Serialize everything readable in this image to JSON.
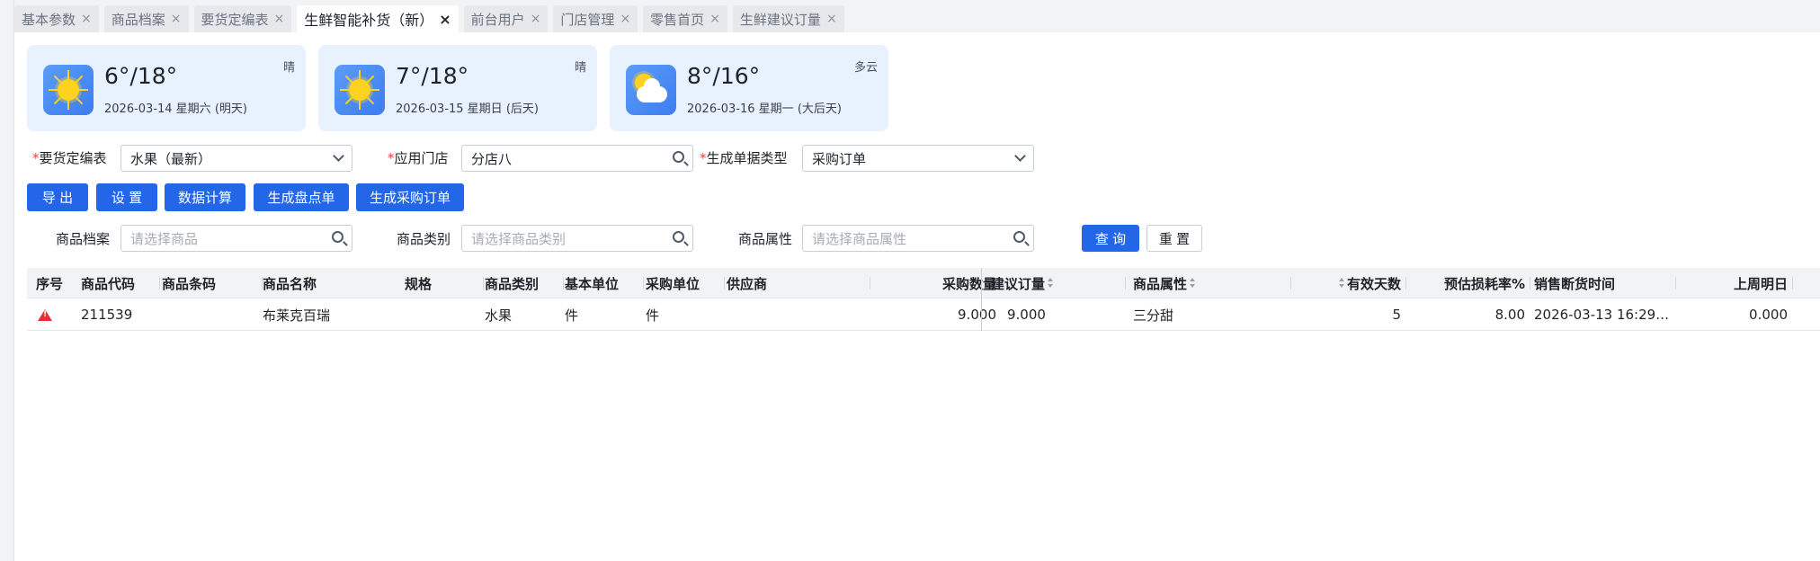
{
  "tabs": [
    {
      "label": "基本参数",
      "active": false
    },
    {
      "label": "商品档案",
      "active": false
    },
    {
      "label": "要货定编表",
      "active": false
    },
    {
      "label": "生鲜智能补货（新）",
      "active": true
    },
    {
      "label": "前台用户",
      "active": false
    },
    {
      "label": "门店管理",
      "active": false
    },
    {
      "label": "零售首页",
      "active": false
    },
    {
      "label": "生鲜建议订量",
      "active": false
    }
  ],
  "tab_close_glyph": "×",
  "weather": [
    {
      "temp": "6°/18°",
      "date": "2026-03-14 星期六 (明天)",
      "condition": "晴",
      "icon": "sun-icon"
    },
    {
      "temp": "7°/18°",
      "date": "2026-03-15 星期日 (后天)",
      "condition": "晴",
      "icon": "sun-icon"
    },
    {
      "temp": "8°/16°",
      "date": "2026-03-16 星期一 (大后天)",
      "condition": "多云",
      "icon": "partly-cloudy-icon"
    }
  ],
  "form": {
    "required_mark": "*",
    "order_table_label": "要货定编表",
    "order_table_value": "水果（最新）",
    "store_label": "应用门店",
    "store_value": "分店八",
    "doc_type_label": "生成单据类型",
    "doc_type_value": "采购订单"
  },
  "actions": {
    "export": "导 出",
    "settings": "设 置",
    "compute": "数据计算",
    "gen_inventory": "生成盘点单",
    "gen_purchase": "生成采购订单"
  },
  "filters": {
    "product_label": "商品档案",
    "product_placeholder": "请选择商品",
    "category_label": "商品类别",
    "category_placeholder": "请选择商品类别",
    "attr_label": "商品属性",
    "attr_placeholder": "请选择商品属性",
    "query": "查 询",
    "reset": "重 置"
  },
  "table": {
    "columns": [
      "序号",
      "商品代码",
      "商品条码",
      "商品名称",
      "规格",
      "商品类别",
      "基本单位",
      "采购单位",
      "供应商",
      "采购数量",
      "建议订量",
      "商品属性",
      "有效天数",
      "预估损耗率%",
      "销售断货时间",
      "上周明日"
    ],
    "rows": [
      {
        "code": "211539",
        "barcode": "",
        "name": "布莱克百瑞",
        "spec": "",
        "category": "水果",
        "base_unit": "件",
        "purchase_unit": "件",
        "supplier": "",
        "purchase_qty": "9.000",
        "suggested_qty": "9.000",
        "attribute": "三分甜",
        "valid_days": "5",
        "loss_rate": "8.00",
        "stockout_time": "2026-03-13 16:29…",
        "last_week_tomorrow": "0.000"
      }
    ]
  },
  "colors": {
    "primary": "#2466e8",
    "weather_card": "#e8f2ff",
    "warning": "#e5303a",
    "required": "#f53f3f"
  }
}
